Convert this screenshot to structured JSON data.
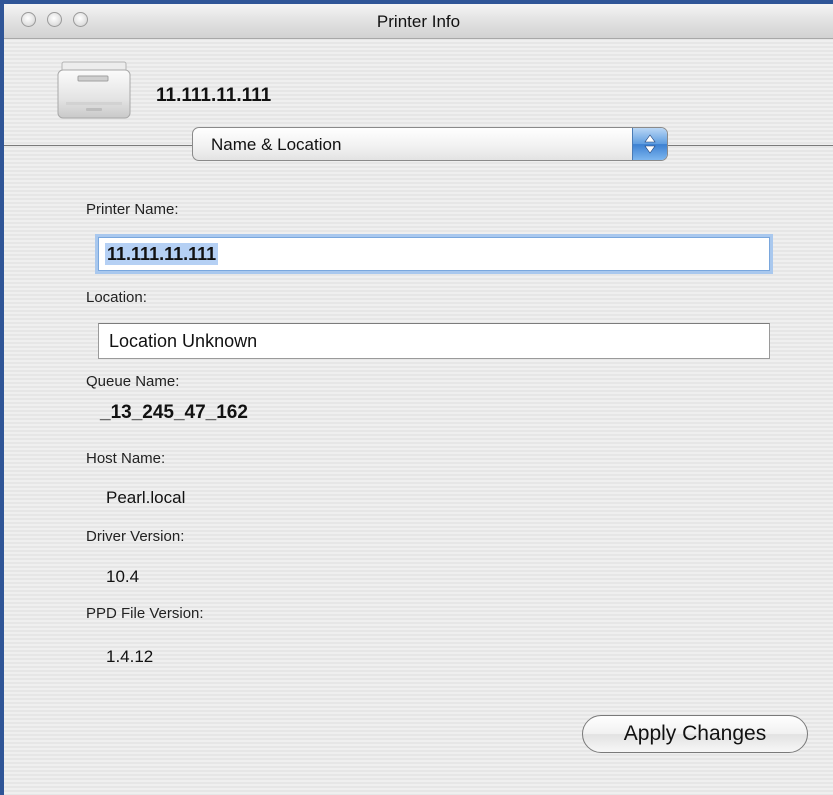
{
  "window": {
    "title": "Printer Info"
  },
  "printer": {
    "ip": "11.111.11.111"
  },
  "panel_selector": {
    "selected": "Name & Location"
  },
  "fields": {
    "printer_name_label": "Printer Name:",
    "printer_name_value": "11.111.11.111",
    "location_label": "Location:",
    "location_value": "Location Unknown",
    "queue_name_label": "Queue Name:",
    "queue_name_value": "_13_245_47_162",
    "host_name_label": "Host Name:",
    "host_name_value": "Pearl.local",
    "driver_version_label": "Driver Version:",
    "driver_version_value": "10.4",
    "ppd_version_label": "PPD File Version:",
    "ppd_version_value": "1.4.12"
  },
  "buttons": {
    "apply": "Apply Changes"
  }
}
